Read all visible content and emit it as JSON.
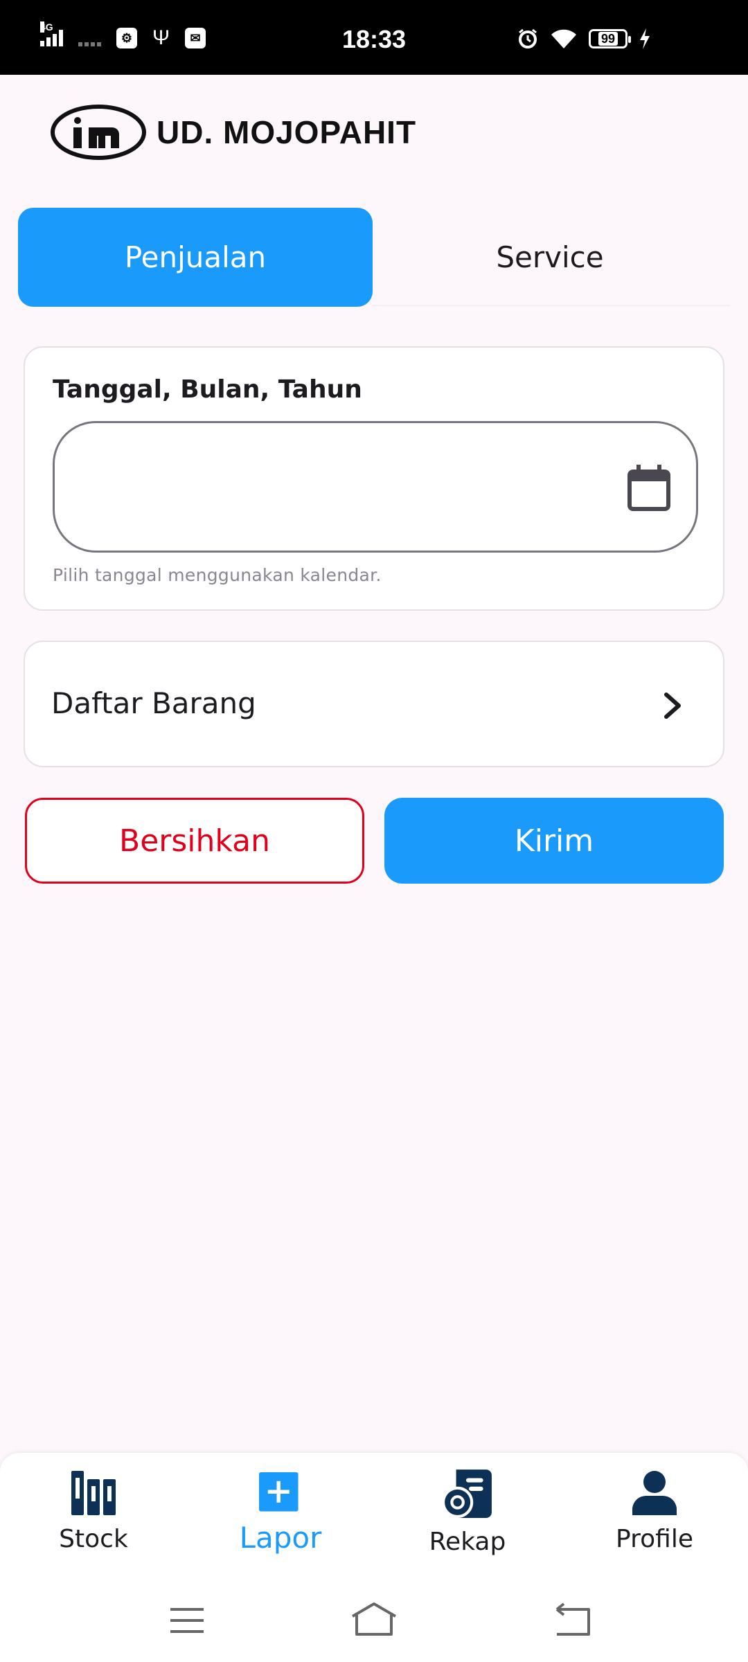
{
  "status_bar": {
    "time": "18:33",
    "network": "4G",
    "battery": "99",
    "icons": [
      "signal-icon",
      "usb-debug-icon",
      "usb-icon",
      "mail-icon",
      "alarm-icon",
      "wifi-icon",
      "battery-icon",
      "charging-icon"
    ]
  },
  "header": {
    "brand": "UD. MOJOPAHIT",
    "logo_icon": "mojopahit-logo"
  },
  "tabs": [
    {
      "label": "Penjualan",
      "active": true
    },
    {
      "label": "Service",
      "active": false
    }
  ],
  "form": {
    "date_label": "Tanggal, Bulan, Tahun",
    "date_value": "",
    "date_help": "Pilih tanggal menggunakan kalendar.",
    "item_list_label": "Daftar Barang"
  },
  "actions": {
    "clear_label": "Bersihkan",
    "send_label": "Kirim"
  },
  "bottom_nav": [
    {
      "label": "Stock",
      "icon": "books-icon",
      "active": false
    },
    {
      "label": "Lapor",
      "icon": "add-box-icon",
      "active": true
    },
    {
      "label": "Rekap",
      "icon": "receipt-icon",
      "active": false
    },
    {
      "label": "Profile",
      "icon": "person-icon",
      "active": false
    }
  ],
  "colors": {
    "accent": "#1a9bfc",
    "danger": "#e0001b",
    "nav_icon": "#0d3155",
    "background": "#fdf7fb"
  }
}
